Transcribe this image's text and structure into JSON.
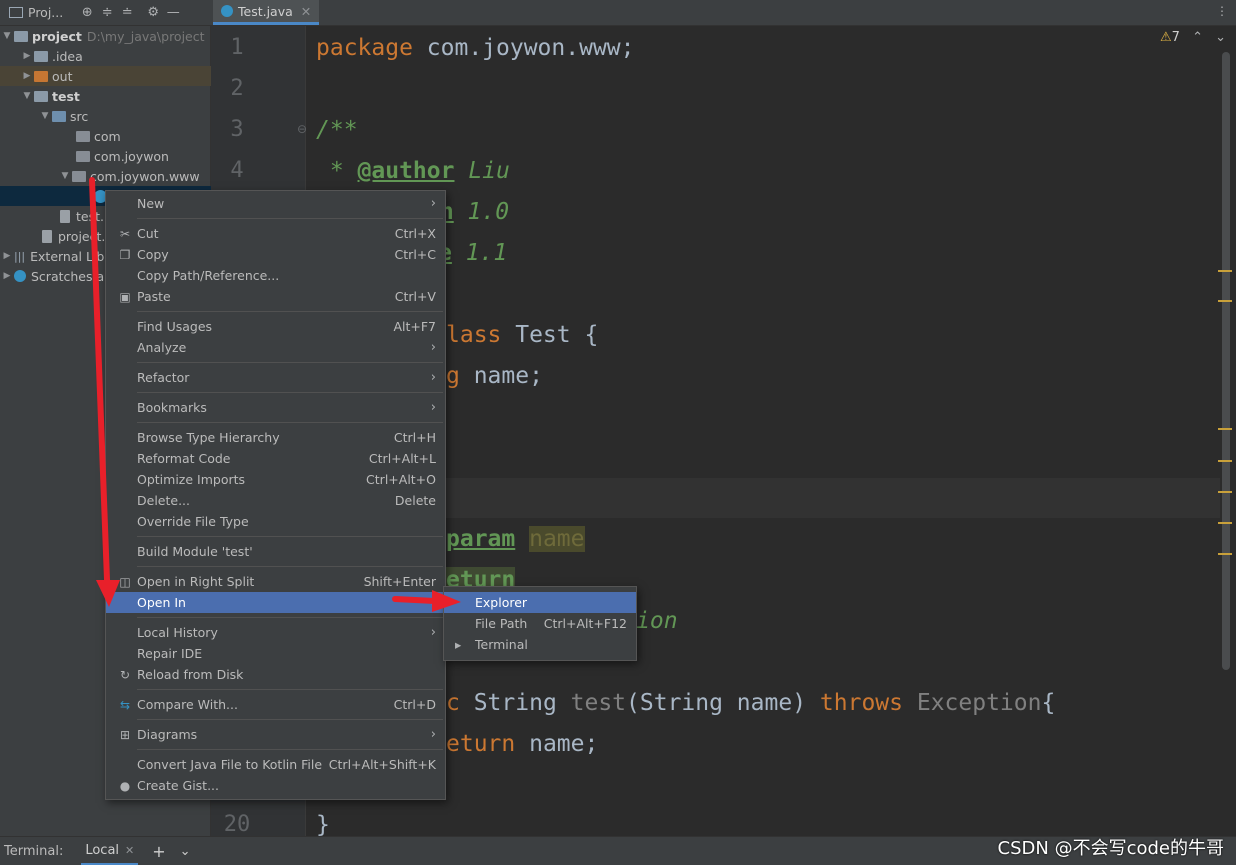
{
  "project_panel": {
    "title": "Proj...",
    "tree": [
      {
        "label": "project",
        "hint": "D:\\my_java\\project",
        "kind": "module"
      },
      {
        "label": ".idea",
        "kind": "folder"
      },
      {
        "label": "out",
        "kind": "folder-orange"
      },
      {
        "label": "test",
        "kind": "module"
      },
      {
        "label": "src",
        "kind": "folder-blue"
      },
      {
        "label": "com",
        "kind": "package"
      },
      {
        "label": "com.joywon",
        "kind": "package"
      },
      {
        "label": "com.joywon.www",
        "kind": "package"
      },
      {
        "label": "",
        "kind": "class"
      },
      {
        "label": "test.i",
        "kind": "file"
      },
      {
        "label": "project.i",
        "kind": "file"
      },
      {
        "label": "External Lib",
        "kind": "libs"
      },
      {
        "label": "Scratches a",
        "kind": "scratch"
      }
    ]
  },
  "editor": {
    "tab_label": "Test.java",
    "warnings_count": "7",
    "line_numbers": [
      "1",
      "2",
      "3",
      "4",
      "20"
    ],
    "code": {
      "l1_kw": "package",
      "l1_rest": " com.joywon.www;",
      "l3": "/**",
      "l4_star": " * ",
      "l4_tag": "@author",
      "l4_val": " Liu",
      "l5_tag": "on",
      "l5_val": " 1.0",
      "l6_tag": "e",
      "l6_val": " 1.1",
      "l8_kw": "lass",
      "l8_rest": " Test {",
      "l9_kw": "g",
      "l9_rest": " name;",
      "l12_tag": "param",
      "l12_val": "name",
      "l13_tag": "eturn",
      "l14_val": "ion",
      "l16_kw1": "c",
      "l16_mid": " String ",
      "l16_fn": "test",
      "l16_args": "(String name) ",
      "l16_kw2": "throws",
      "l16_exc": " Exception",
      "l16_brace": "{",
      "l17_kw": "eturn",
      "l17_rest": " name;",
      "l20": "}"
    }
  },
  "context_menu": {
    "items": [
      {
        "label": "New",
        "submenu": true
      },
      {
        "label": "Cut",
        "shortcut": "Ctrl+X",
        "icon": "scissors-icon"
      },
      {
        "label": "Copy",
        "shortcut": "Ctrl+C",
        "icon": "copy-icon"
      },
      {
        "label": "Copy Path/Reference..."
      },
      {
        "label": "Paste",
        "shortcut": "Ctrl+V",
        "icon": "paste-icon"
      },
      {
        "label": "Find Usages",
        "shortcut": "Alt+F7"
      },
      {
        "label": "Analyze",
        "submenu": true
      },
      {
        "label": "Refactor",
        "submenu": true
      },
      {
        "label": "Bookmarks",
        "submenu": true
      },
      {
        "label": "Browse Type Hierarchy",
        "shortcut": "Ctrl+H"
      },
      {
        "label": "Reformat Code",
        "shortcut": "Ctrl+Alt+L"
      },
      {
        "label": "Optimize Imports",
        "shortcut": "Ctrl+Alt+O"
      },
      {
        "label": "Delete...",
        "shortcut": "Delete"
      },
      {
        "label": "Override File Type"
      },
      {
        "label": "Build Module 'test'"
      },
      {
        "label": "Open in Right Split",
        "shortcut": "Shift+Enter",
        "icon": "split-icon"
      },
      {
        "label": "Open In",
        "submenu": true
      },
      {
        "label": "Local History",
        "submenu": true
      },
      {
        "label": "Repair IDE"
      },
      {
        "label": "Reload from Disk",
        "icon": "reload-icon"
      },
      {
        "label": "Compare With...",
        "shortcut": "Ctrl+D",
        "icon": "compare-icon"
      },
      {
        "label": "Diagrams",
        "submenu": true,
        "icon": "diagram-icon"
      },
      {
        "label": "Convert Java File to Kotlin File",
        "shortcut": "Ctrl+Alt+Shift+K"
      },
      {
        "label": "Create Gist...",
        "icon": "github-icon"
      }
    ]
  },
  "submenu": {
    "items": [
      {
        "label": "Explorer"
      },
      {
        "label": "File Path",
        "shortcut": "Ctrl+Alt+F12"
      },
      {
        "label": "Terminal",
        "icon": "terminal-icon"
      }
    ]
  },
  "bottom_bar": {
    "label": "Terminal:",
    "tab": "Local"
  },
  "watermark": "CSDN @不会写code的牛哥",
  "colors": {
    "selection": "#4b6eaf",
    "keyword": "#cc7832",
    "doc_comment": "#629755",
    "annotation_arrow": "#e8202a"
  }
}
